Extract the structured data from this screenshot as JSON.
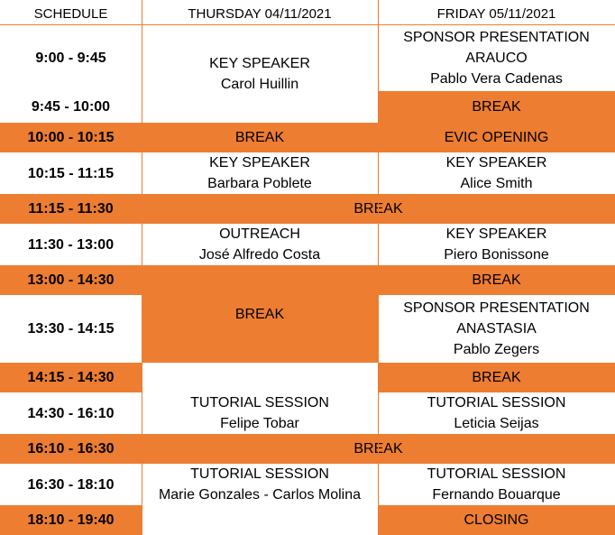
{
  "header": {
    "schedule": "SCHEDULE",
    "day1": "THURSDAY 04/11/2021",
    "day2": "FRIDAY  05/11/2021"
  },
  "times": [
    "9:00 - 9:45",
    "9:45 - 10:00",
    "10:00 - 10:15",
    "10:15 - 11:15",
    "11:15 - 11:30",
    "11:30 - 13:00",
    "13:00 - 14:30",
    "13:30 - 14:15",
    "14:15 - 14:30",
    "14:30 - 16:10",
    "16:10 - 16:30",
    "16:30 - 18:10",
    "18:10 - 19:40"
  ],
  "thursday": {
    "slot1": {
      "title": "KEY SPEAKER",
      "speaker": "Carol Huillin"
    },
    "break1": "BREAK",
    "slot2": {
      "title": "KEY SPEAKER",
      "speaker": "Barbara Poblete"
    },
    "slot3": {
      "title": "OUTREACH",
      "speaker": "José Alfredo Costa"
    },
    "break2": "BREAK",
    "slot4": {
      "title": "TUTORIAL SESSION",
      "speaker": "Felipe Tobar"
    },
    "slot5": {
      "title": "TUTORIAL SESSION",
      "speaker": "Marie Gonzales - Carlos Molina"
    }
  },
  "friday": {
    "slot1": {
      "title": "SPONSOR PRESENTATION",
      "company": "ARAUCO",
      "speaker": "Pablo Vera Cadenas"
    },
    "break1": "BREAK",
    "opening": "EVIC OPENING",
    "slot2": {
      "title": "KEY SPEAKER",
      "speaker": "Alice Smith"
    },
    "slot3": {
      "title": "KEY SPEAKER",
      "speaker": "Piero Bonissone"
    },
    "break2": "BREAK",
    "slot4": {
      "title": "SPONSOR PRESENTATION",
      "company": "ANASTASIA",
      "speaker": "Pablo Zegers"
    },
    "break3": "BREAK",
    "slot5": {
      "title": "TUTORIAL SESSION",
      "speaker": "Leticia Seijas"
    },
    "slot6": {
      "title": "TUTORIAL SESSION",
      "speaker": "Fernando Bouarque"
    },
    "closing": "CLOSING"
  },
  "shared": {
    "break_1115": "BREAK",
    "break_1610": "BREAK"
  },
  "colors": {
    "accent": "#ed7d31",
    "background": "#ffffff"
  }
}
